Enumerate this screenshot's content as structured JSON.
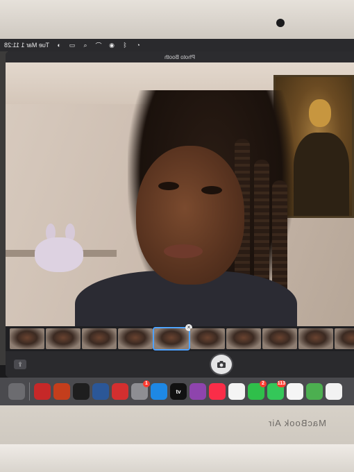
{
  "menubar": {
    "datetime": "Tue Mar 1  11:28",
    "icons": [
      "bluetooth-icon",
      "wifi-icon",
      "search-icon",
      "control-center-icon",
      "siri-icon",
      "battery-icon",
      "clock-icon"
    ]
  },
  "window": {
    "title": "Photo Booth"
  },
  "filmstrip": {
    "thumbnail_count": 10,
    "selected_index": 4,
    "delete_glyph": "×"
  },
  "controls": {
    "share_icon": "share-icon",
    "shutter_icon": "camera-icon"
  },
  "dock": {
    "items": [
      {
        "name": "trash",
        "icon": "trash-icon",
        "color": "#6c6c70"
      },
      {
        "name": "photobooth",
        "icon": "photobooth-icon",
        "color": "#c62828"
      },
      {
        "name": "powerpoint",
        "icon": "powerpoint-icon",
        "color": "#c43e1c"
      },
      {
        "name": "terminal",
        "icon": "terminal-icon",
        "color": "#1e1e1e"
      },
      {
        "name": "word",
        "icon": "word-icon",
        "color": "#2b5797"
      },
      {
        "name": "acrobat",
        "icon": "acrobat-icon",
        "color": "#d32f2f"
      },
      {
        "name": "system-preferences",
        "icon": "gear-icon",
        "color": "#8e8e93",
        "badge": "1"
      },
      {
        "name": "app-store",
        "icon": "app-store-icon",
        "color": "#1e88e5"
      },
      {
        "name": "apple-tv",
        "icon": "tv-icon",
        "color": "#111111",
        "label": "tv"
      },
      {
        "name": "podcasts",
        "icon": "podcasts-icon",
        "color": "#8e44ad"
      },
      {
        "name": "music",
        "icon": "music-icon",
        "color": "#fa2d48"
      },
      {
        "name": "news",
        "icon": "news-icon",
        "color": "#f4f4f4"
      },
      {
        "name": "facetime",
        "icon": "facetime-icon",
        "color": "#2fbf4a",
        "badge": "2"
      },
      {
        "name": "messages",
        "icon": "messages-icon",
        "color": "#34c759",
        "badge": "113"
      },
      {
        "name": "photos",
        "icon": "photos-icon",
        "color": "#f5f5f5"
      },
      {
        "name": "maps",
        "icon": "maps-icon",
        "color": "#4caf50"
      },
      {
        "name": "calendar",
        "icon": "calendar-icon",
        "color": "#f2f2f2"
      }
    ]
  },
  "hardware": {
    "brand": "MacBook Air"
  }
}
